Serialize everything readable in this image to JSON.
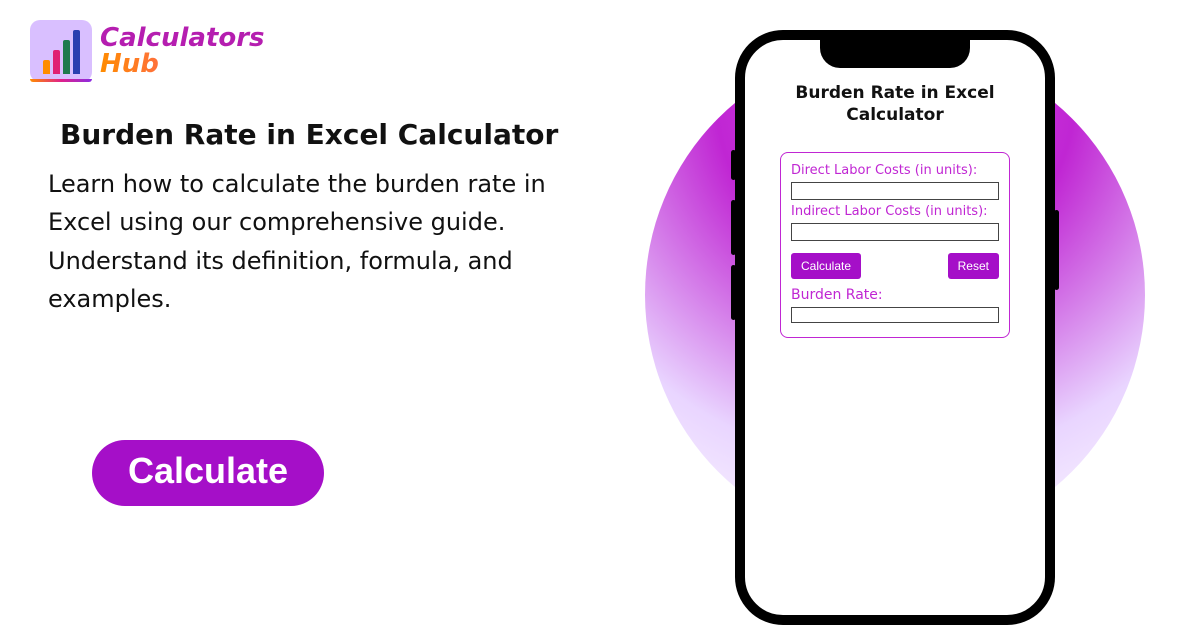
{
  "brand": {
    "line1": "Calculators",
    "line2": "Hub"
  },
  "heading": "Burden Rate in Excel Calculator",
  "description": "Learn how to calculate the burden rate in Excel using our comprehensive guide. Understand its definition, formula, and examples.",
  "cta_label": "Calculate",
  "phone": {
    "title": "Burden Rate in Excel Calculator",
    "field1_label": "Direct Labor Costs (in units):",
    "field2_label": "Indirect Labor Costs (in units):",
    "calc_btn": "Calculate",
    "reset_btn": "Reset",
    "output_label": "Burden Rate:"
  }
}
